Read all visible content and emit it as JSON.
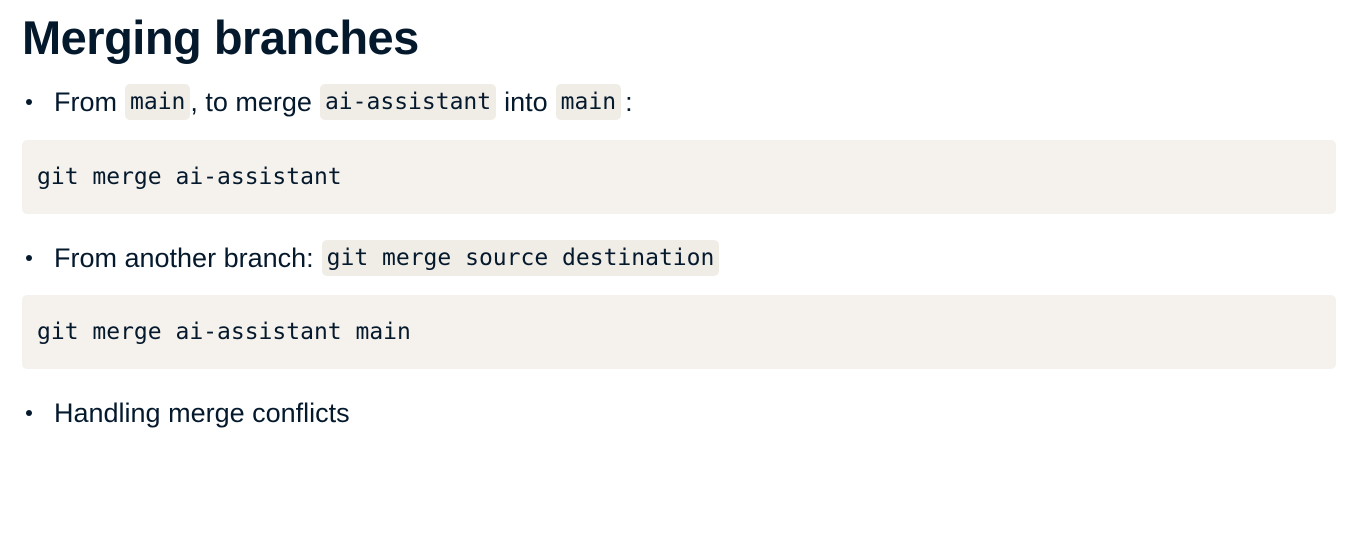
{
  "slide": {
    "title": "Merging branches",
    "bullet1": {
      "text_from": "From",
      "code_main": "main",
      "text_to_merge": ", to merge",
      "code_branch": "ai-assistant",
      "text_into": "into",
      "code_target": "main",
      "text_colon": ":"
    },
    "codeblock1": "git merge ai-assistant",
    "bullet2": {
      "text": "From another branch:",
      "code": "git merge source destination"
    },
    "codeblock2": "git merge ai-assistant main",
    "bullet3": {
      "text": "Handling merge conflicts"
    }
  }
}
